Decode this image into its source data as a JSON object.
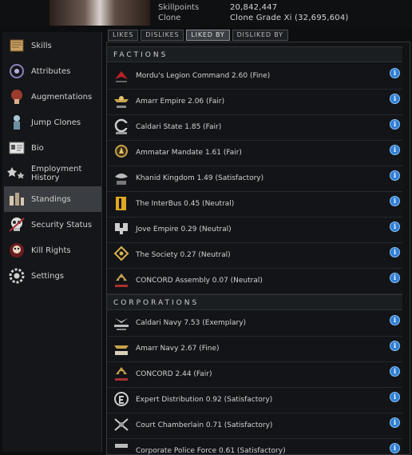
{
  "header": {
    "skillpoints_label": "Skillpoints",
    "skillpoints_value": "20,842,447",
    "clone_label": "Clone",
    "clone_value": "Clone Grade Xi (32,695,604)"
  },
  "sidebar": {
    "items": [
      {
        "label": "Skills",
        "icon": "skills-book-icon"
      },
      {
        "label": "Attributes",
        "icon": "attributes-icon"
      },
      {
        "label": "Augmentations",
        "icon": "augmentations-icon"
      },
      {
        "label": "Jump Clones",
        "icon": "jump-clones-icon"
      },
      {
        "label": "Bio",
        "icon": "bio-icon"
      },
      {
        "label": "Employment\nHistory",
        "icon": "employment-history-icon"
      },
      {
        "label": "Standings",
        "icon": "standings-icon"
      },
      {
        "label": "Security Status",
        "icon": "security-status-icon"
      },
      {
        "label": "Kill Rights",
        "icon": "kill-rights-icon"
      },
      {
        "label": "Settings",
        "icon": "settings-icon"
      }
    ],
    "active_index": 6
  },
  "tabs": [
    {
      "label": "LIKES"
    },
    {
      "label": "DISLIKES"
    },
    {
      "label": "LIKED BY"
    },
    {
      "label": "DISLIKED BY"
    }
  ],
  "active_tab": 2,
  "sections": {
    "factions_title": "FACTIONS",
    "corporations_title": "CORPORATIONS"
  },
  "factions": [
    {
      "text": "Mordu's Legion Command 2.60 (Fine)",
      "icon": "mordus-legion-logo-icon"
    },
    {
      "text": "Amarr Empire 2.06 (Fair)",
      "icon": "amarr-logo-icon"
    },
    {
      "text": "Caldari State 1.85 (Fair)",
      "icon": "caldari-logo-icon"
    },
    {
      "text": "Ammatar Mandate 1.61 (Fair)",
      "icon": "ammatar-logo-icon"
    },
    {
      "text": "Khanid Kingdom 1.49 (Satisfactory)",
      "icon": "khanid-logo-icon"
    },
    {
      "text": "The InterBus 0.45 (Neutral)",
      "icon": "interbus-logo-icon"
    },
    {
      "text": "Jove Empire 0.29 (Neutral)",
      "icon": "jove-logo-icon"
    },
    {
      "text": "The Society 0.27 (Neutral)",
      "icon": "society-logo-icon"
    },
    {
      "text": "CONCORD Assembly 0.07 (Neutral)",
      "icon": "concord-logo-icon"
    }
  ],
  "corporations": [
    {
      "text": "Caldari Navy 7.53 (Exemplary)",
      "icon": "caldari-navy-logo-icon"
    },
    {
      "text": "Amarr Navy 2.67 (Fine)",
      "icon": "amarr-navy-logo-icon"
    },
    {
      "text": "CONCORD 2.44 (Fair)",
      "icon": "concord-logo-icon"
    },
    {
      "text": "Expert Distribution 0.92 (Satisfactory)",
      "icon": "expert-distribution-logo-icon"
    },
    {
      "text": "Court Chamberlain 0.71 (Satisfactory)",
      "icon": "court-chamberlain-logo-icon"
    },
    {
      "text": "Corporate Police Force 0.61 (Satisfactory)",
      "icon": "corporate-police-logo-icon"
    }
  ],
  "info_glyph": "i",
  "colors": {
    "accent": "#2f7fd6",
    "active_row": "#3a3d41",
    "panel": "#101214"
  }
}
